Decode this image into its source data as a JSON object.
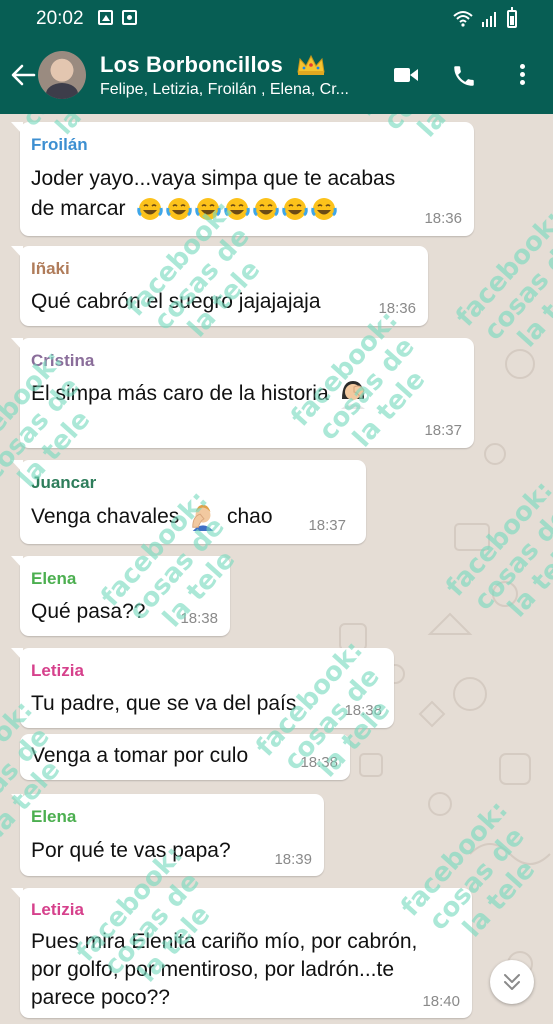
{
  "status_bar": {
    "time": "20:02"
  },
  "header": {
    "group_name": "Los Borboncillos",
    "members": "Felipe, Letizia, Froilán , Elena, Cr..."
  },
  "messages": [
    {
      "sender": "Froilán",
      "sender_color": "#3d8fd1",
      "lines": [
        "Joder yayo...vaya simpa que te acabas",
        "de marcar"
      ],
      "emoji": "face-with-tears-of-joy x7",
      "time": "18:36"
    },
    {
      "sender": "Iñaki",
      "sender_color": "#b07c5a",
      "lines": [
        "Qué cabrón el suegro jajajajaja"
      ],
      "time": "18:36"
    },
    {
      "sender": "Cristina",
      "sender_color": "#8a6d9a",
      "lines": [
        "El simpa más caro de la historia"
      ],
      "emoji": "woman-facepalming",
      "time": "18:37"
    },
    {
      "sender": "Juancar",
      "sender_color": "#2e7d5b",
      "lines": [
        "Venga chavales",
        "chao"
      ],
      "emoji": "man-facepalming",
      "time": "18:37"
    },
    {
      "sender": "Elena",
      "sender_color": "#4caf50",
      "lines": [
        "Qué pasa??"
      ],
      "time": "18:38"
    },
    {
      "sender": "Letizia",
      "sender_color": "#d6418c",
      "lines": [
        "Tu padre, que se va del país"
      ],
      "time": "18:38"
    },
    {
      "sender": "",
      "lines": [
        "Venga a tomar por culo"
      ],
      "time": "18:38"
    },
    {
      "sender": "Elena",
      "sender_color": "#4caf50",
      "lines": [
        "Por qué te vas papa?"
      ],
      "time": "18:39"
    },
    {
      "sender": "Letizia",
      "sender_color": "#d6418c",
      "lines": [
        "Pues mira Elenita cariño mío,  por cabrón,",
        "por golfo, por mentiroso, por ladrón...te",
        "parece poco??"
      ],
      "time": "18:40"
    }
  ],
  "watermark": {
    "line1": "facebook:",
    "line2": "cosas de",
    "line3": "la tele"
  },
  "colors": {
    "header_bg": "#075e54",
    "chat_bg": "#e5ddd5",
    "bubble_bg": "#ffffff",
    "watermark": "#78dabe"
  }
}
